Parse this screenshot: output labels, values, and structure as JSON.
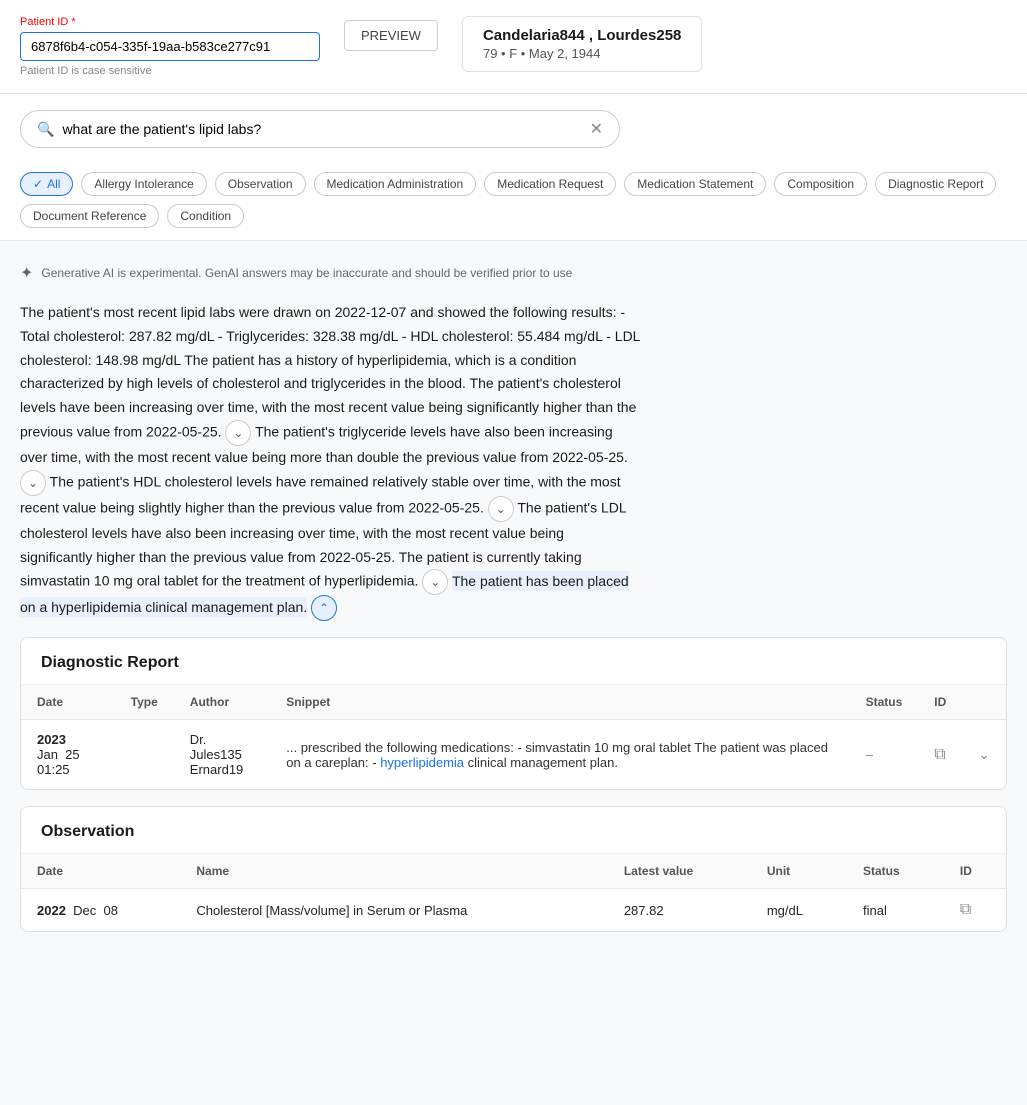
{
  "topBar": {
    "patientIdLabel": "Patient ID",
    "required": "*",
    "patientIdValue": "6878f6b4-c054-335f-19aa-b583ce277c91",
    "patientIdHint": "Patient ID is case sensitive",
    "previewBtn": "PREVIEW",
    "patientName": "Candelaria844 , Lourdes258",
    "patientDetails": "79 • F • May 2, 1944"
  },
  "search": {
    "placeholder": "what are the patient's lipid labs?",
    "value": "what are the patient's lipid labs?"
  },
  "filters": [
    {
      "id": "all",
      "label": "All",
      "active": true
    },
    {
      "id": "allergy-intolerance",
      "label": "Allergy Intolerance",
      "active": false
    },
    {
      "id": "observation",
      "label": "Observation",
      "active": false
    },
    {
      "id": "medication-administration",
      "label": "Medication Administration",
      "active": false
    },
    {
      "id": "medication-request",
      "label": "Medication Request",
      "active": false
    },
    {
      "id": "medication-statement",
      "label": "Medication Statement",
      "active": false
    },
    {
      "id": "composition",
      "label": "Composition",
      "active": false
    },
    {
      "id": "diagnostic-report",
      "label": "Diagnostic Report",
      "active": false
    },
    {
      "id": "document-reference",
      "label": "Document Reference",
      "active": false
    },
    {
      "id": "condition",
      "label": "Condition",
      "active": false
    }
  ],
  "aiNotice": "Generative AI is experimental. GenAI answers may be inaccurate and should be verified prior to use",
  "answerParts": {
    "part1": "The patient's most recent lipid labs were drawn on 2022-12-07 and showed the following results: - Total cholesterol: 287.82 mg/dL - Triglycerides: 328.38 mg/dL - HDL cholesterol: 55.484 mg/dL - LDL cholesterol: 148.98 mg/dL The patient has a history of hyperlipidemia, which is a condition characterized by high levels of cholesterol and triglycerides in the blood. The patient's cholesterol levels have been increasing over time, with the most recent value being significantly higher than the previous value from 2022-05-25.",
    "part2": "The patient's triglyceride levels have also been increasing over time, with the most recent value being more than double the previous value from 2022-05-25.",
    "part3": "The patient's HDL cholesterol levels have remained relatively stable over time, with the most recent value being slightly higher than the previous value from 2022-05-25.",
    "part4": "The patient's LDL cholesterol levels have also been increasing over time, with the most recent value being significantly higher than the previous value from 2022-05-25. The patient is currently taking simvastatin 10 mg oral tablet for the treatment of hyperlipidemia.",
    "part5": "The patient has been placed on a hyperlipidemia clinical management plan."
  },
  "diagnosticReport": {
    "sectionTitle": "Diagnostic Report",
    "columns": [
      "Date",
      "Type",
      "Author",
      "Snippet",
      "Status",
      "ID"
    ],
    "rows": [
      {
        "dateYear": "2023",
        "dateRest": "Jan  25  01:25",
        "type": "",
        "author1": "Dr. Jules135",
        "author2": "Ernard19",
        "snippetPre": "... prescribed the following medications: - simvastatin 10 mg oral tablet The patient was placed on a careplan: -",
        "snippetHighlight": "hyperlipidemia",
        "snippetPost": "clinical management plan.",
        "status": "–",
        "id": "copy"
      }
    ]
  },
  "observation": {
    "sectionTitle": "Observation",
    "columns": [
      "Date",
      "Name",
      "Latest value",
      "Unit",
      "Status",
      "ID"
    ],
    "rows": [
      {
        "dateYear": "2022",
        "dateRest": "Dec  08",
        "name": "Cholesterol [Mass/volume] in Serum or Plasma",
        "latestValue": "287.82",
        "unit": "mg/dL",
        "status": "final",
        "id": "copy"
      }
    ]
  }
}
